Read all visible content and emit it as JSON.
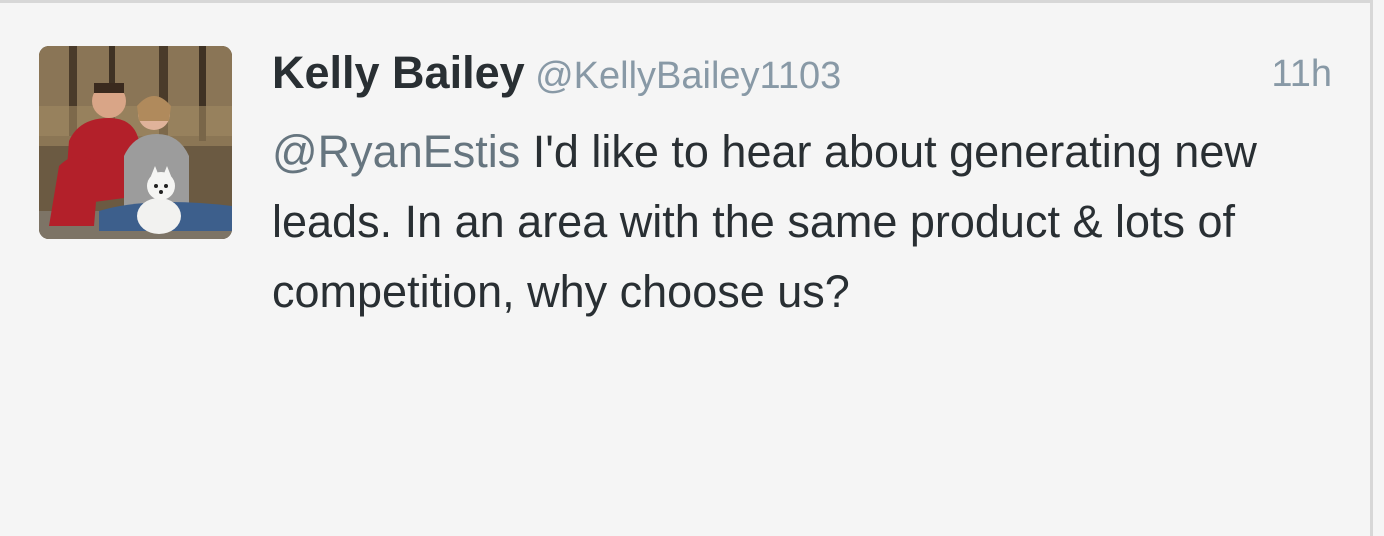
{
  "tweet": {
    "display_name": "Kelly Bailey",
    "screen_name": "@KellyBailey1103",
    "timestamp": "11h",
    "mention": "@RyanEstis",
    "text": " I'd like to hear about generating new leads. In an area with the same product & lots of competition, why choose us?"
  },
  "avatar": {
    "icon": "profile-photo"
  }
}
